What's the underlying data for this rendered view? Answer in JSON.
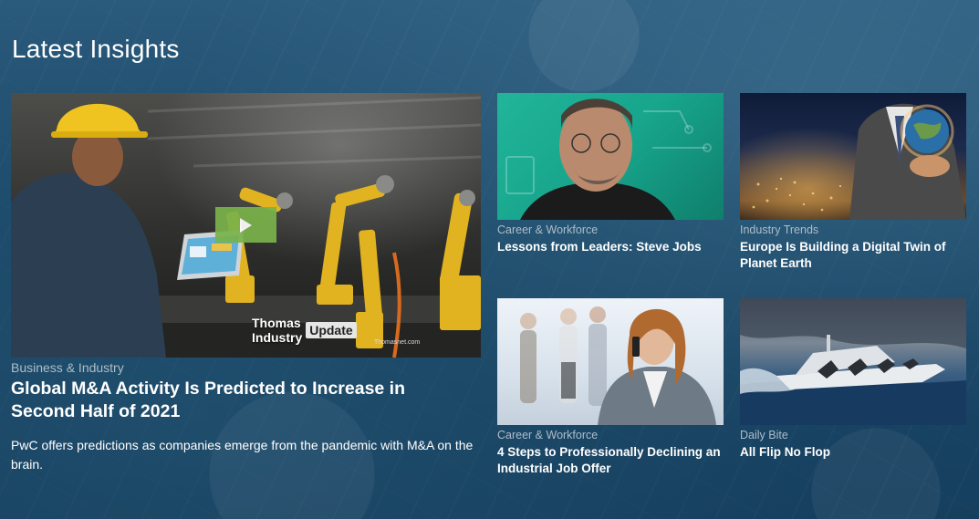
{
  "section": {
    "title": "Latest Insights"
  },
  "featured": {
    "category": "Business & Industry",
    "headline": "Global M&A Activity Is Predicted to Increase in Second Half of 2021",
    "description": "PwC offers predictions as companies emerge from the pandemic with M&A on the brain.",
    "watermark_brand": "Thomas Industry",
    "watermark_tag": "Update",
    "watermark_site": "Thomasnet.com",
    "play_icon": "play-icon",
    "play_color": "#7ab24a"
  },
  "cards": [
    {
      "category": "Career & Workforce",
      "headline": "Lessons from Leaders: Steve Jobs"
    },
    {
      "category": "Industry Trends",
      "headline": "Europe Is Building a Digital Twin of Planet Earth"
    },
    {
      "category": "Career & Workforce",
      "headline": "4 Steps to Professionally Declining an Industrial Job Offer"
    },
    {
      "category": "Daily Bite",
      "headline": "All Flip No Flop"
    }
  ],
  "colors": {
    "background": "#1d4d6d",
    "category": "#aebdc9",
    "text": "#ffffff"
  }
}
